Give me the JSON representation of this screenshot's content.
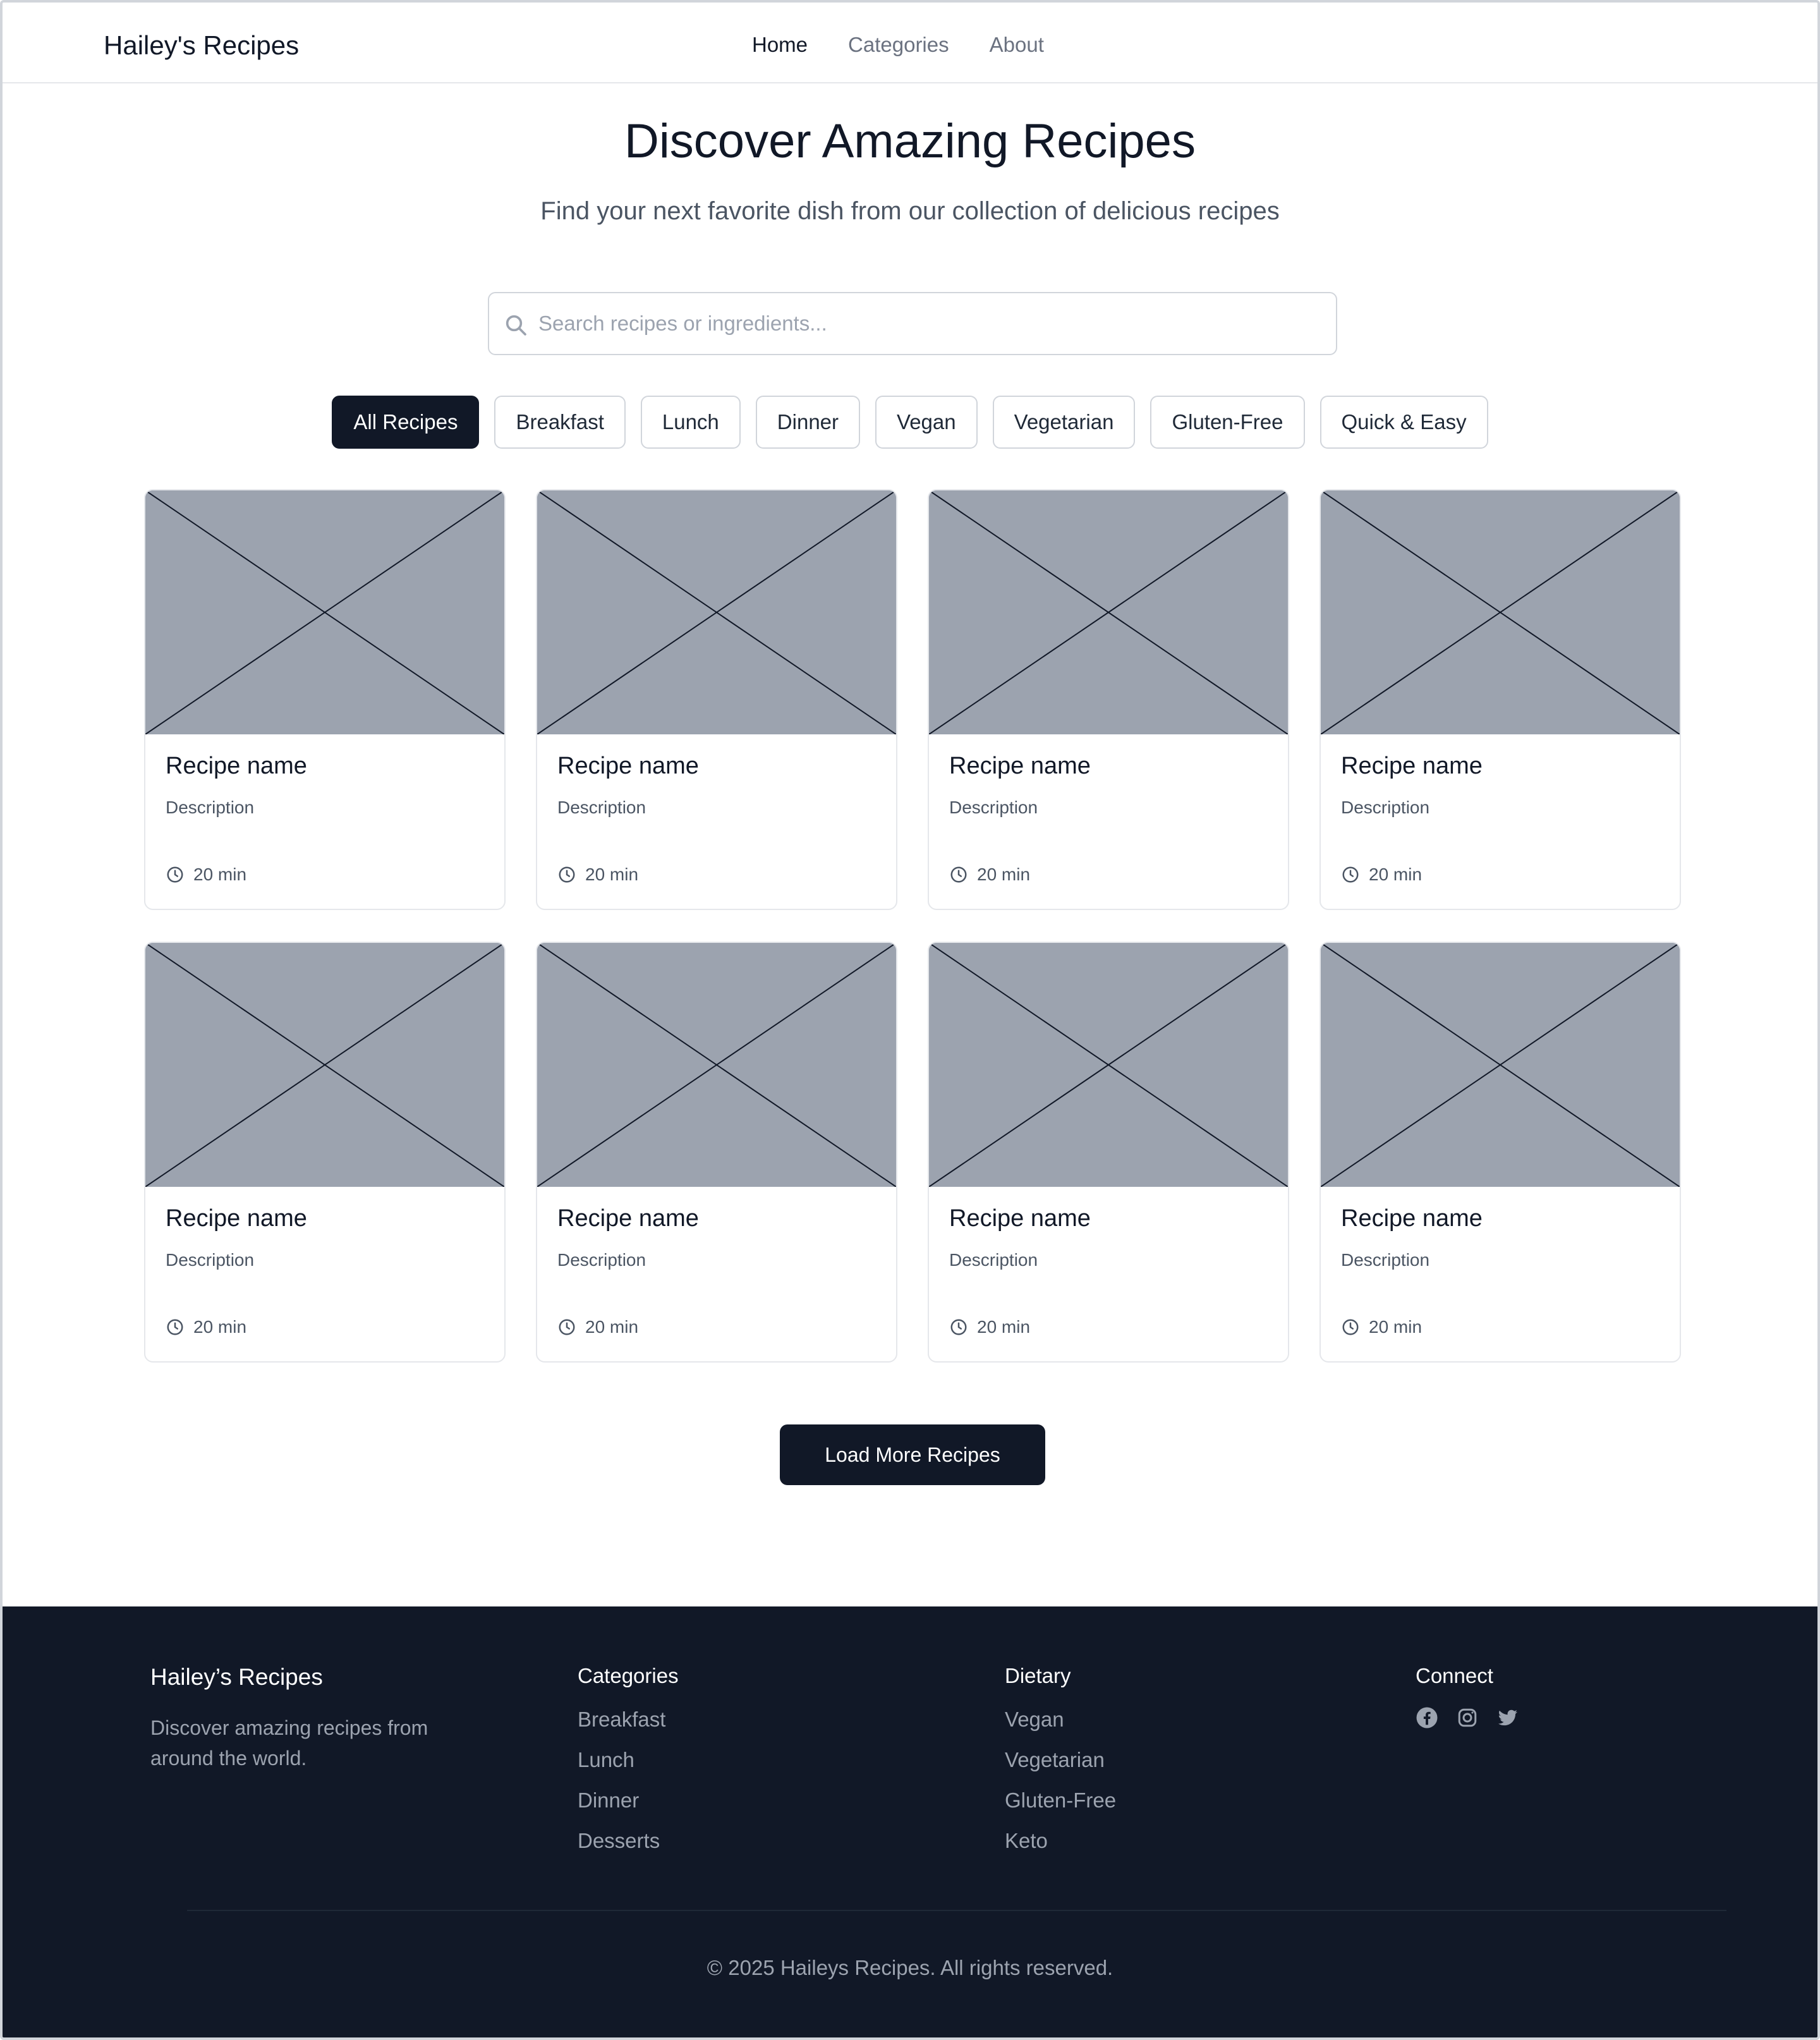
{
  "header": {
    "brand": "Hailey's Recipes",
    "nav": [
      {
        "label": "Home",
        "active": true
      },
      {
        "label": "Categories",
        "active": false
      },
      {
        "label": "About",
        "active": false
      }
    ]
  },
  "hero": {
    "title": "Discover Amazing Recipes",
    "subtitle": "Find your next favorite dish from our collection of delicious recipes"
  },
  "search": {
    "placeholder": "Search recipes or ingredients...",
    "value": "",
    "icon": "search-icon"
  },
  "filters": [
    {
      "label": "All Recipes",
      "active": true
    },
    {
      "label": "Breakfast",
      "active": false
    },
    {
      "label": "Lunch",
      "active": false
    },
    {
      "label": "Dinner",
      "active": false
    },
    {
      "label": "Vegan",
      "active": false
    },
    {
      "label": "Vegetarian",
      "active": false
    },
    {
      "label": "Gluten-Free",
      "active": false
    },
    {
      "label": "Quick & Easy",
      "active": false
    }
  ],
  "recipes": [
    {
      "name": "Recipe name",
      "description": "Description",
      "time": "20 min"
    },
    {
      "name": "Recipe name",
      "description": "Description",
      "time": "20 min"
    },
    {
      "name": "Recipe name",
      "description": "Description",
      "time": "20 min"
    },
    {
      "name": "Recipe name",
      "description": "Description",
      "time": "20 min"
    },
    {
      "name": "Recipe name",
      "description": "Description",
      "time": "20 min"
    },
    {
      "name": "Recipe name",
      "description": "Description",
      "time": "20 min"
    },
    {
      "name": "Recipe name",
      "description": "Description",
      "time": "20 min"
    },
    {
      "name": "Recipe name",
      "description": "Description",
      "time": "20 min"
    }
  ],
  "load_more_label": "Load More Recipes",
  "footer": {
    "brand": "Hailey’s Recipes",
    "description": "Discover amazing recipes from around the world.",
    "categories": {
      "heading": "Categories",
      "links": [
        "Breakfast",
        "Lunch",
        "Dinner",
        "Desserts"
      ]
    },
    "dietary": {
      "heading": "Dietary",
      "links": [
        "Vegan",
        "Vegetarian",
        "Gluten-Free",
        "Keto"
      ]
    },
    "connect": {
      "heading": "Connect",
      "icons": [
        "facebook-icon",
        "instagram-icon",
        "twitter-icon"
      ]
    },
    "copyright": "© 2025 Haileys Recipes. All rights reserved."
  },
  "colors": {
    "primary": "#111827",
    "muted_text": "#6b7280",
    "placeholder_image": "#9ca3af",
    "border": "#d1d5db",
    "footer_bg": "#111827"
  }
}
